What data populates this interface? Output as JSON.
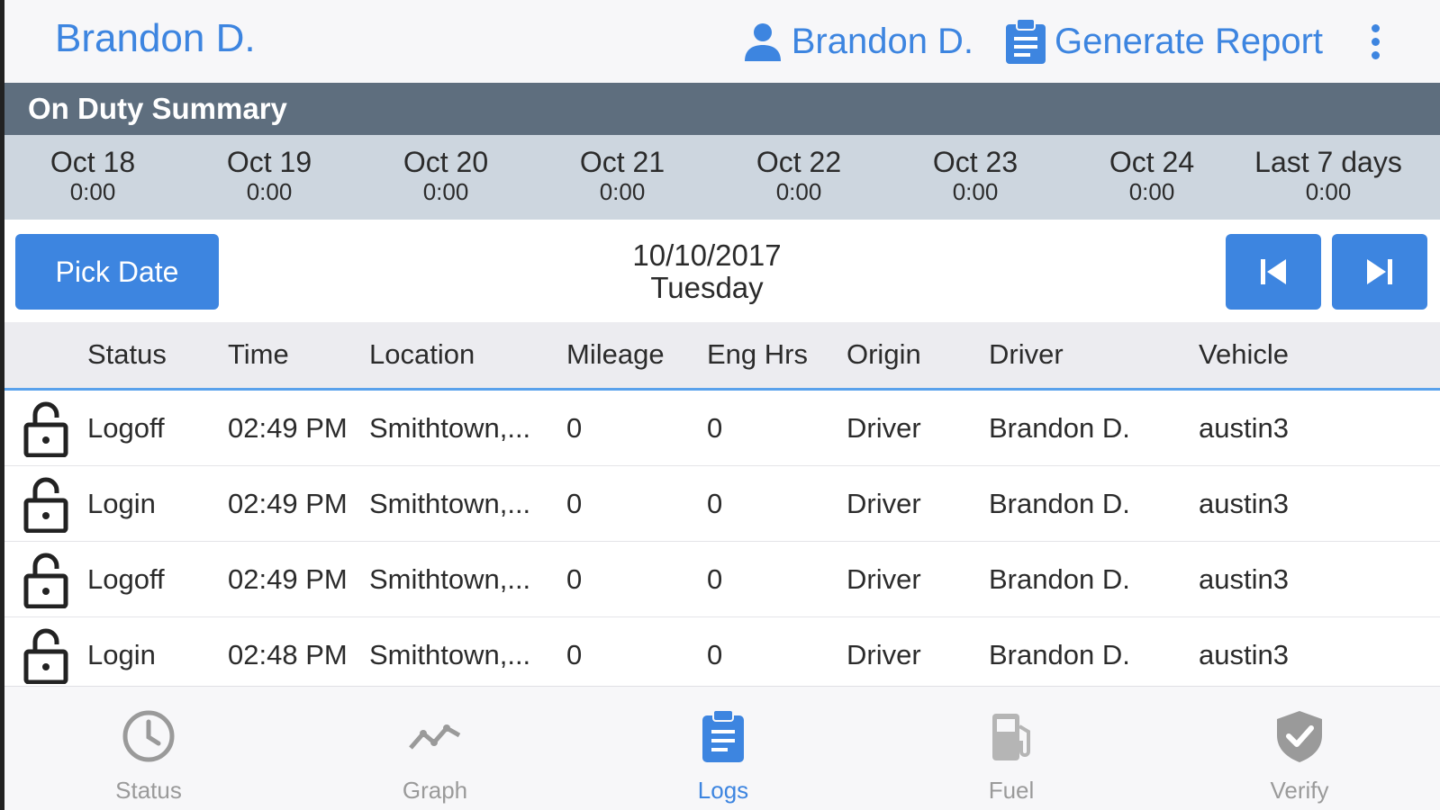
{
  "colors": {
    "accent": "#3d85e0",
    "summary_bar": "#5e6e7e",
    "days_strip": "#cdd6df",
    "inactive_tab": "#9a9a9a"
  },
  "header": {
    "title": "Brandon D.",
    "user_label": "Brandon D.",
    "user_icon": "person-icon",
    "report_label": "Generate Report",
    "report_icon": "clipboard-icon",
    "more_icon": "more-vertical-icon"
  },
  "summary": {
    "title": "On Duty Summary",
    "days": [
      {
        "label": "Oct 18",
        "value": "0:00"
      },
      {
        "label": "Oct 19",
        "value": "0:00"
      },
      {
        "label": "Oct 20",
        "value": "0:00"
      },
      {
        "label": "Oct 21",
        "value": "0:00"
      },
      {
        "label": "Oct 22",
        "value": "0:00"
      },
      {
        "label": "Oct 23",
        "value": "0:00"
      },
      {
        "label": "Oct 24",
        "value": "0:00"
      },
      {
        "label": "Last 7 days",
        "value": "0:00"
      }
    ]
  },
  "date_nav": {
    "pick_date_label": "Pick Date",
    "date": "10/10/2017",
    "weekday": "Tuesday",
    "prev_icon": "skip-previous-icon",
    "next_icon": "skip-next-icon"
  },
  "table": {
    "columns": [
      "Status",
      "Time",
      "Location",
      "Mileage",
      "Eng Hrs",
      "Origin",
      "Driver",
      "Vehicle"
    ],
    "rows": [
      {
        "icon": "unlock-icon",
        "status": "Logoff",
        "time": "02:49 PM",
        "location": "Smithtown,...",
        "mileage": "0",
        "eng_hrs": "0",
        "origin": "Driver",
        "driver": "Brandon D.",
        "vehicle": "austin3"
      },
      {
        "icon": "unlock-icon",
        "status": "Login",
        "time": "02:49 PM",
        "location": "Smithtown,...",
        "mileage": "0",
        "eng_hrs": "0",
        "origin": "Driver",
        "driver": "Brandon D.",
        "vehicle": "austin3"
      },
      {
        "icon": "unlock-icon",
        "status": "Logoff",
        "time": "02:49 PM",
        "location": "Smithtown,...",
        "mileage": "0",
        "eng_hrs": "0",
        "origin": "Driver",
        "driver": "Brandon D.",
        "vehicle": "austin3"
      },
      {
        "icon": "unlock-icon",
        "status": "Login",
        "time": "02:48 PM",
        "location": "Smithtown,...",
        "mileage": "0",
        "eng_hrs": "0",
        "origin": "Driver",
        "driver": "Brandon D.",
        "vehicle": "austin3"
      }
    ]
  },
  "tabs": [
    {
      "label": "Status",
      "icon": "clock-icon",
      "active": false
    },
    {
      "label": "Graph",
      "icon": "line-chart-icon",
      "active": false
    },
    {
      "label": "Logs",
      "icon": "clipboard-icon",
      "active": true
    },
    {
      "label": "Fuel",
      "icon": "fuel-pump-icon",
      "active": false
    },
    {
      "label": "Verify",
      "icon": "shield-check-icon",
      "active": false
    }
  ]
}
